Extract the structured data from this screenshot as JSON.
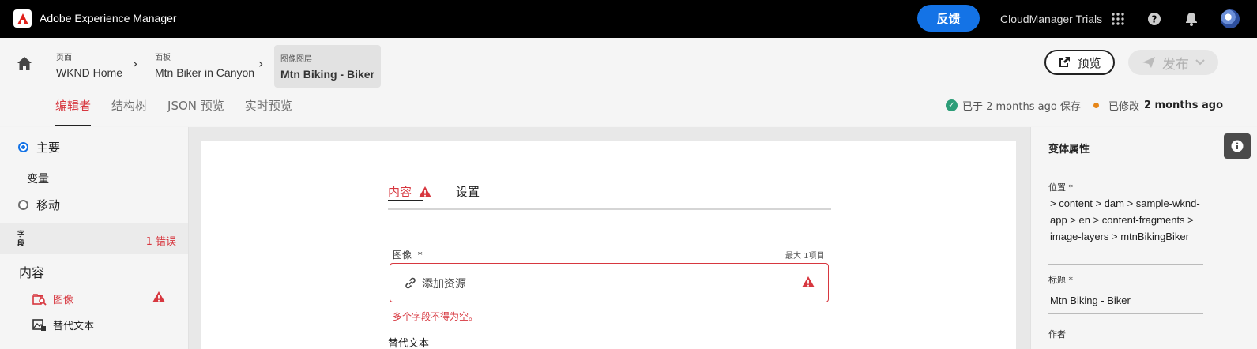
{
  "topbar": {
    "app_title": "Adobe Experience Manager",
    "feedback_label": "反馈",
    "org_name": "CloudManager Trials",
    "icons": [
      "apps-grid-icon",
      "help-icon",
      "notifications-bell-icon",
      "user-avatar"
    ]
  },
  "breadcrumb": [
    {
      "small": "页面",
      "big": "WKND Home"
    },
    {
      "small": "面板",
      "big": "Mtn Biker in Canyon"
    },
    {
      "small": "图像图层",
      "big": "Mtn Biking - Biker"
    }
  ],
  "actions": {
    "preview_label": "预览",
    "publish_label": "发布"
  },
  "tabs": [
    "编辑者",
    "结构树",
    "JSON 预览",
    "实时预览"
  ],
  "status": {
    "saved_text": "已于 2 months ago 保存",
    "modified_label": "已修改",
    "modified_time": "2 months ago"
  },
  "left_panel": {
    "variations": {
      "main": "主要",
      "heading": "变量",
      "mobile": "移动"
    },
    "fields_label": "字段",
    "errors_label": "1 错误",
    "content_heading": "内容",
    "fields": [
      {
        "label": "图像",
        "error": true
      },
      {
        "label": "替代文本",
        "error": false
      }
    ]
  },
  "editor": {
    "tabs": [
      "内容",
      "设置"
    ],
    "image_label": "图像",
    "required_mark": "*",
    "max_items": "最大 1项目",
    "add_asset": "添加资源",
    "error_message": "多个字段不得为空。",
    "alt_text_label": "替代文本"
  },
  "right_panel": {
    "title": "变体属性",
    "location_label": "位置 *",
    "location_value": " > content > dam > sample-wknd-app > en > content-fragments > image-layers > mtnBikingBiker",
    "title_label": "标题 *",
    "title_value": "Mtn Biking - Biker",
    "author_label": "作者"
  },
  "colors": {
    "accent_blue": "#1473e6",
    "error_red": "#d7373f",
    "success_green": "#2d9d78",
    "modified_orange": "#e68619"
  }
}
